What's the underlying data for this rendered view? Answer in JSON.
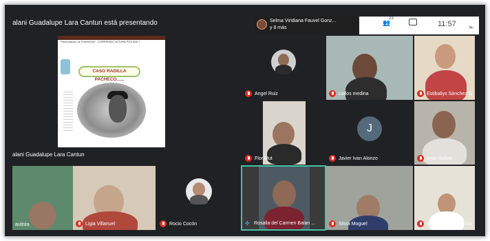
{
  "presentation": {
    "banner": "alani Guadalupe Lara Cantun está presentando",
    "presenter_label": "alani Guadalupe Lara Cantun",
    "slide_header": "Presentación de PowerPoint - CORRIENDO ALTURA PIOLAVA ?",
    "slide_title": "CASO RADILLA PACHECO......"
  },
  "notification": {
    "line1": "Selma Viridiana Fauvel Gonz...",
    "line2": "y 8 más"
  },
  "controls": {
    "people_icon": "people-icon",
    "people_count": "23",
    "chat_icon": "chat-icon",
    "time": "11:57",
    "caret": "ᴺᵘ"
  },
  "participants": [
    {
      "name": "Angel Ruiz",
      "muted": true
    },
    {
      "name": "carlos medina",
      "muted": true
    },
    {
      "name": "Estibaliys Sánchez G",
      "muted": true
    },
    {
      "name": "Flor Mut",
      "muted": true
    },
    {
      "name": "Javier Ivan Alonzo",
      "muted": true,
      "initial": "J"
    },
    {
      "name": "Jose Ruben",
      "muted": true
    },
    {
      "name": "autista",
      "muted": false
    },
    {
      "name": "Ligia Villanuel",
      "muted": true
    },
    {
      "name": "Rocio Cocón",
      "muted": true
    },
    {
      "name": "Rosalia del Carmen Balan ...",
      "muted": false,
      "speaking": true
    },
    {
      "name": "Silvia Moguel",
      "muted": true
    },
    {
      "name": "Wendy Ramírez Díaz",
      "muted": true
    }
  ],
  "colors": {
    "background": "#202124",
    "tile": "#3c4043",
    "muted_red": "#d93025",
    "active_speaker_border": "#41c4a5"
  }
}
